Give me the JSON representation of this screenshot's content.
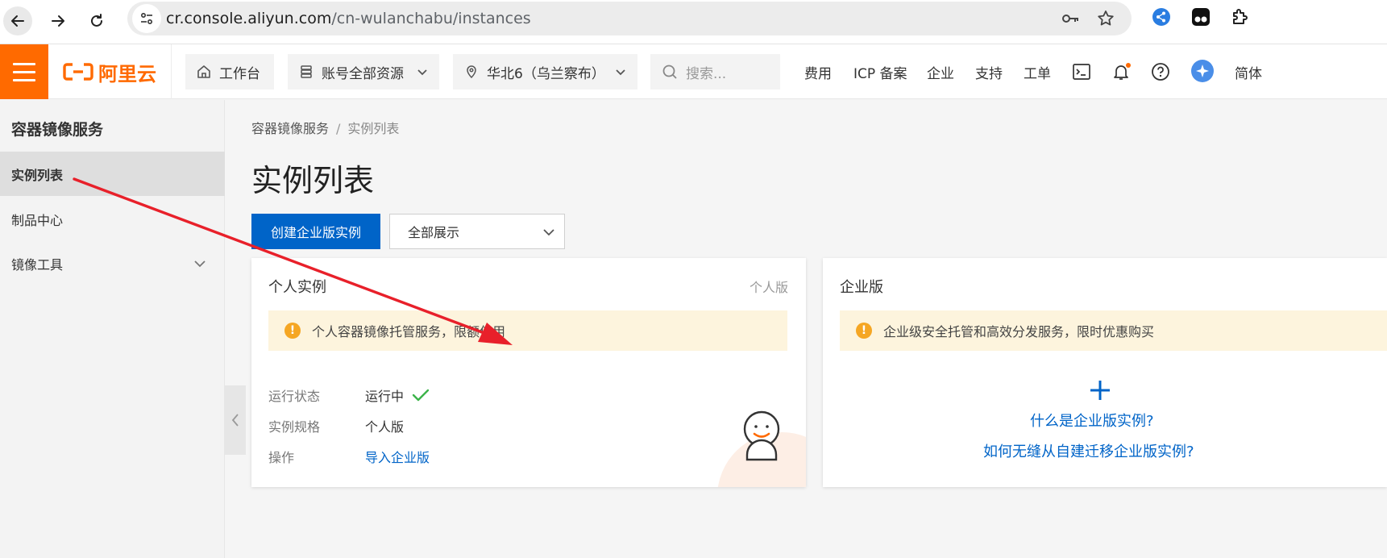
{
  "browser": {
    "url_host": "cr.console.aliyun.com",
    "url_path": "/cn-wulanchabu/instances"
  },
  "topbar": {
    "logo_text": "阿里云",
    "workbench_label": "工作台",
    "resource_label": "账号全部资源",
    "region_label": "华北6（乌兰察布）",
    "search_placeholder": "搜索...",
    "links": [
      "费用",
      "ICP 备案",
      "企业",
      "支持",
      "工单"
    ],
    "language_label": "简体"
  },
  "sidebar": {
    "title": "容器镜像服务",
    "items": [
      {
        "label": "实例列表",
        "active": true
      },
      {
        "label": "制品中心"
      },
      {
        "label": "镜像工具",
        "expandable": true
      }
    ]
  },
  "main": {
    "breadcrumb": [
      "容器镜像服务",
      "实例列表"
    ],
    "breadcrumb_sep": "/",
    "title": "实例列表",
    "create_button": "创建企业版实例",
    "filter_select": "全部展示"
  },
  "personal_card": {
    "title": "个人实例",
    "tag": "个人版",
    "notice": "个人容器镜像托管服务，限额使用",
    "rows": [
      {
        "label": "运行状态",
        "value": "运行中"
      },
      {
        "label": "实例规格",
        "value": "个人版"
      },
      {
        "label": "操作",
        "value": "导入企业版"
      }
    ]
  },
  "enterprise_card": {
    "title": "企业版",
    "notice": "企业级安全托管和高效分发服务，限时优惠购买",
    "link_what": "什么是企业版实例?",
    "link_migrate": "如何无缝从自建迁移企业版实例?"
  },
  "colors": {
    "brand_orange": "#ff6a00",
    "primary_blue": "#0064c8",
    "annotation_red": "#e8202a",
    "success_green": "#3cb34a"
  }
}
